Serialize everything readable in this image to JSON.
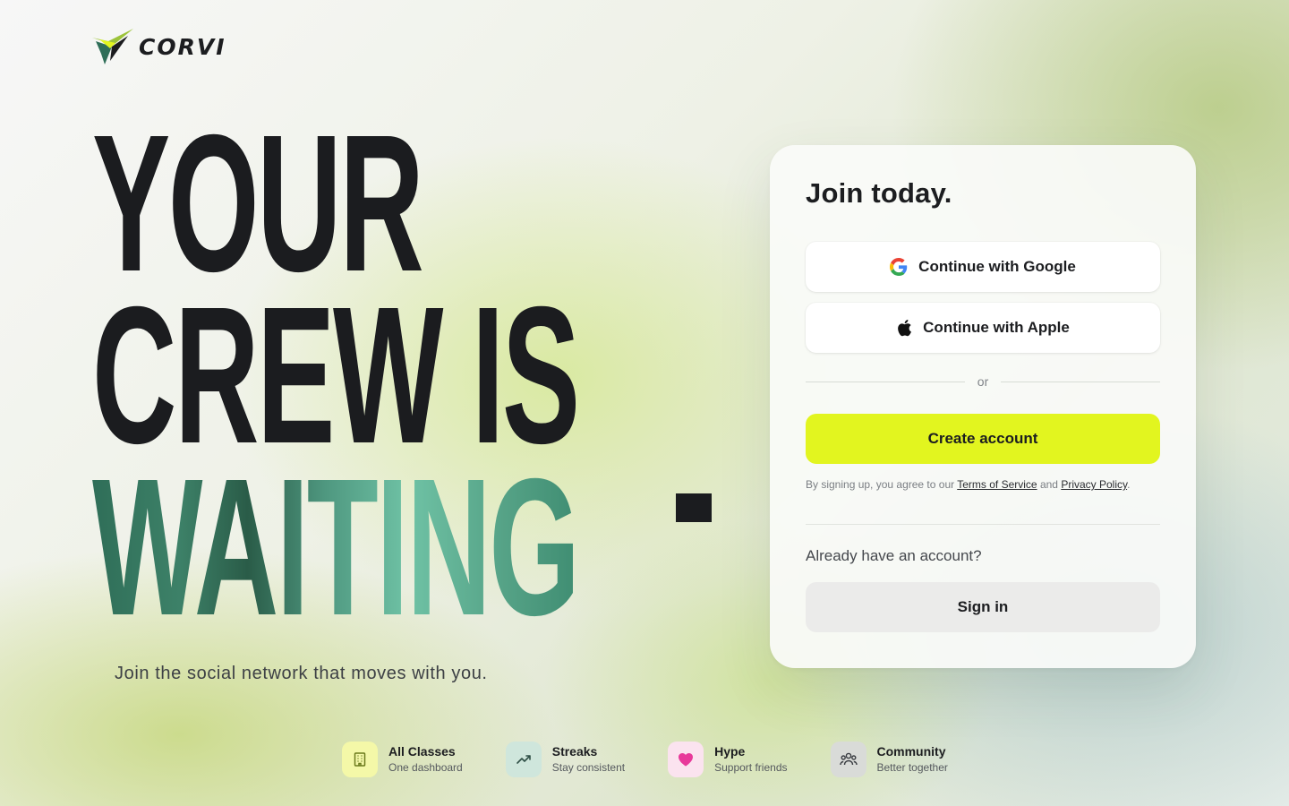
{
  "brand": {
    "name": "CORVI",
    "logo_icon": "corvi-bird-logo"
  },
  "hero": {
    "line1": "YOUR",
    "line2": "CREW IS",
    "line3": "WAITING",
    "subtitle": "Join the social network that moves with you."
  },
  "auth": {
    "title": "Join today.",
    "google_label": "Continue with Google",
    "apple_label": "Continue with Apple",
    "divider_text": "or",
    "create_label": "Create account",
    "legal_prefix": "By signing up, you agree to our",
    "terms_label": "Terms of Service",
    "legal_and": "and",
    "privacy_label": "Privacy Policy",
    "legal_suffix": ".",
    "have_account": "Already have an account?",
    "signin_label": "Sign in"
  },
  "features": [
    {
      "title": "All Classes",
      "subtitle": "One dashboard",
      "icon": "building-icon",
      "color": "#f4f8a8"
    },
    {
      "title": "Streaks",
      "subtitle": "Stay consistent",
      "icon": "trending-up-icon",
      "color": "#cfe6dc"
    },
    {
      "title": "Hype",
      "subtitle": "Support friends",
      "icon": "heart-icon",
      "color": "#fbe3ef"
    },
    {
      "title": "Community",
      "subtitle": "Better together",
      "icon": "users-icon",
      "color": "#d9dbd8"
    }
  ],
  "colors": {
    "accent": "#e2f51f",
    "dark": "#1b1c1f",
    "green": "#3d8168"
  }
}
